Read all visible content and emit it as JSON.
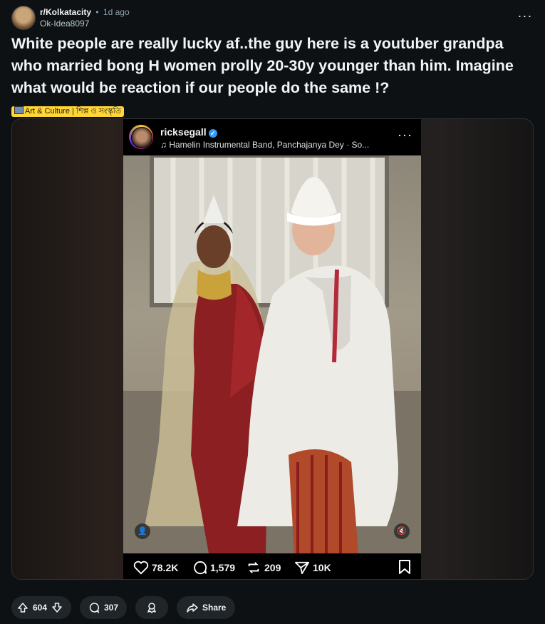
{
  "post": {
    "subreddit": "r/Kolkatacity",
    "separator": "•",
    "time": "1d ago",
    "username": "Ok-Idea8097",
    "more_icon": "more-horizontal-icon",
    "title": "White people are really lucky af..the guy here is a youtuber grandpa who married bong H women prolly 20-30y younger than him. Imagine what would be reaction if our people do the same !?",
    "flair": "Art & Culture | শিল্প ও সংস্কৃতি"
  },
  "embed": {
    "account": "ricksegall",
    "music": "Hamelin Instrumental Band, Panchajanya Dey · So...",
    "likes": "78.2K",
    "comments": "1,579",
    "reposts": "209",
    "shares": "10K"
  },
  "actions": {
    "score": "604",
    "comments": "307",
    "share_label": "Share"
  }
}
